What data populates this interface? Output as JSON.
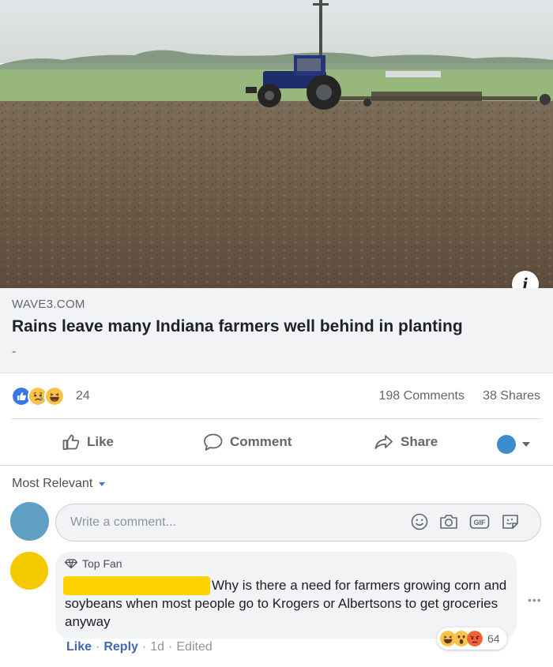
{
  "link_preview": {
    "domain": "WAVE3.COM",
    "title": "Rains leave many Indiana farmers well behind in planting",
    "description": "-",
    "info_glyph": "i"
  },
  "summary": {
    "reaction_icons": [
      "like-icon",
      "sad-icon",
      "haha-icon"
    ],
    "reaction_count": "24",
    "comments": "198 Comments",
    "shares": "38 Shares"
  },
  "actions": {
    "like": "Like",
    "comment": "Comment",
    "share": "Share",
    "audience_color": "#3b8dcf"
  },
  "comments_section": {
    "sort_label": "Most Relevant",
    "input_placeholder": "Write a comment...",
    "input_icons": [
      "emoji-icon",
      "camera-icon",
      "gif-icon",
      "sticker-icon"
    ],
    "comments": [
      {
        "badge": "Top Fan",
        "author_redacted_color": "#ffd200",
        "avatar_color": "#f5c900",
        "text": "Why is there a need for farmers growing corn and soybeans when most people go to Krogers or Albertsons to get groceries anyway",
        "reaction_icons": [
          "haha-icon",
          "wow-icon",
          "angry-icon"
        ],
        "reaction_count": "64",
        "like": "Like",
        "reply": "Reply",
        "time": "1d",
        "edited": "Edited"
      }
    ]
  },
  "colors": {
    "link_blue": "#4267b2",
    "fb_blue": "#3578e5"
  }
}
